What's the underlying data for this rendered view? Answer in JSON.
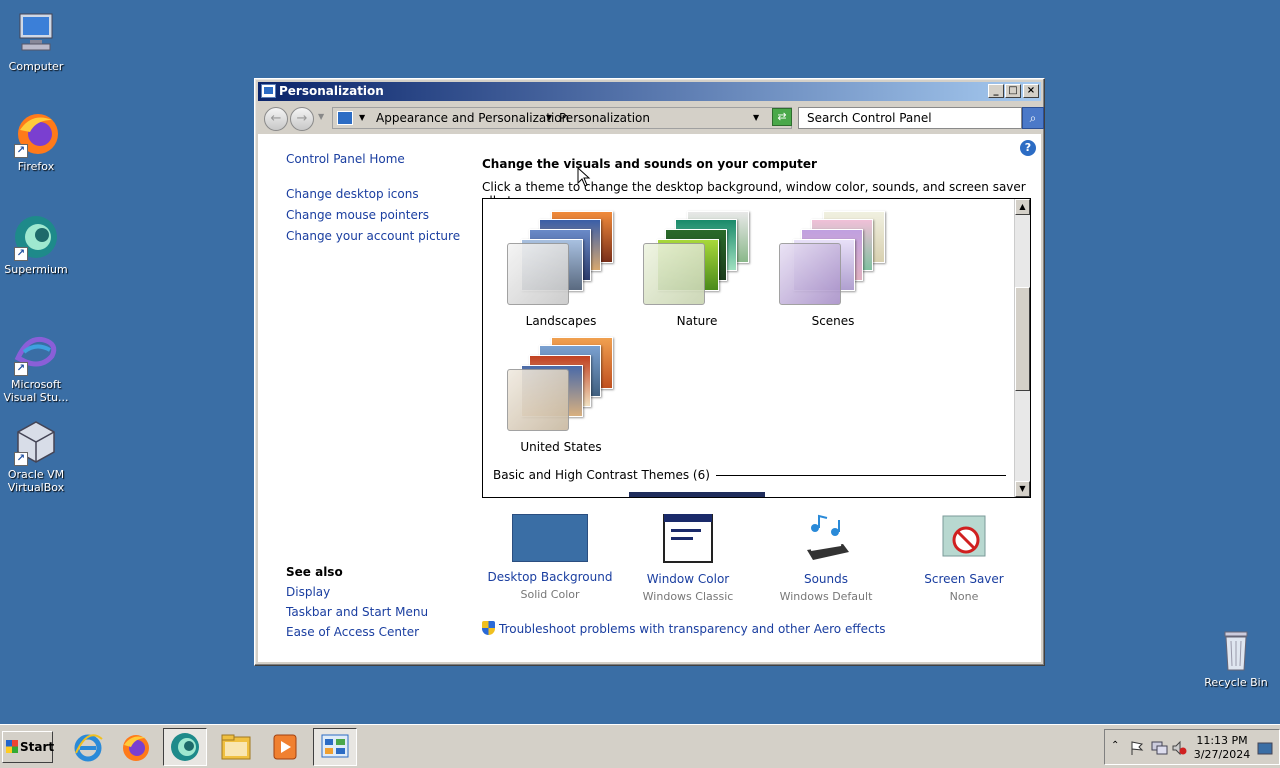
{
  "desktop": {
    "icons": [
      {
        "label": "Computer"
      },
      {
        "label": "Firefox"
      },
      {
        "label": "Supermium"
      },
      {
        "label": "Microsoft Visual Stu..."
      },
      {
        "label": "Oracle VM VirtualBox"
      },
      {
        "label": "Recycle Bin"
      }
    ]
  },
  "window": {
    "title": "Personalization",
    "address": {
      "crumb1": "Appearance and Personalization",
      "crumb2": "Personalization"
    },
    "search_placeholder": "Search Control Panel",
    "left_nav": {
      "home": "Control Panel Home",
      "links": [
        "Change desktop icons",
        "Change mouse pointers",
        "Change your account picture"
      ],
      "see_also_title": "See also",
      "see_also": [
        "Display",
        "Taskbar and Start Menu",
        "Ease of Access Center"
      ]
    },
    "heading": "Change the visuals and sounds on your computer",
    "subtext": "Click a theme to change the desktop background, window color, sounds, and screen saver all at once.",
    "themes": [
      "Landscapes",
      "Nature",
      "Scenes",
      "United States"
    ],
    "basic_section": "Basic and High Contrast Themes (6)",
    "bottom_items": [
      {
        "title": "Desktop Background",
        "sub": "Solid Color"
      },
      {
        "title": "Window Color",
        "sub": "Windows Classic"
      },
      {
        "title": "Sounds",
        "sub": "Windows Default"
      },
      {
        "title": "Screen Saver",
        "sub": "None"
      }
    ],
    "troubleshoot": "Troubleshoot problems with transparency and other Aero effects"
  },
  "taskbar": {
    "start_label": "Start",
    "clock_time": "11:13 PM",
    "clock_date": "3/27/2024"
  },
  "colors": {
    "desktop": "#3a6ea5",
    "link": "#1a3ea0",
    "titlebar_start": "#0a246a",
    "titlebar_end": "#a6caf0"
  }
}
